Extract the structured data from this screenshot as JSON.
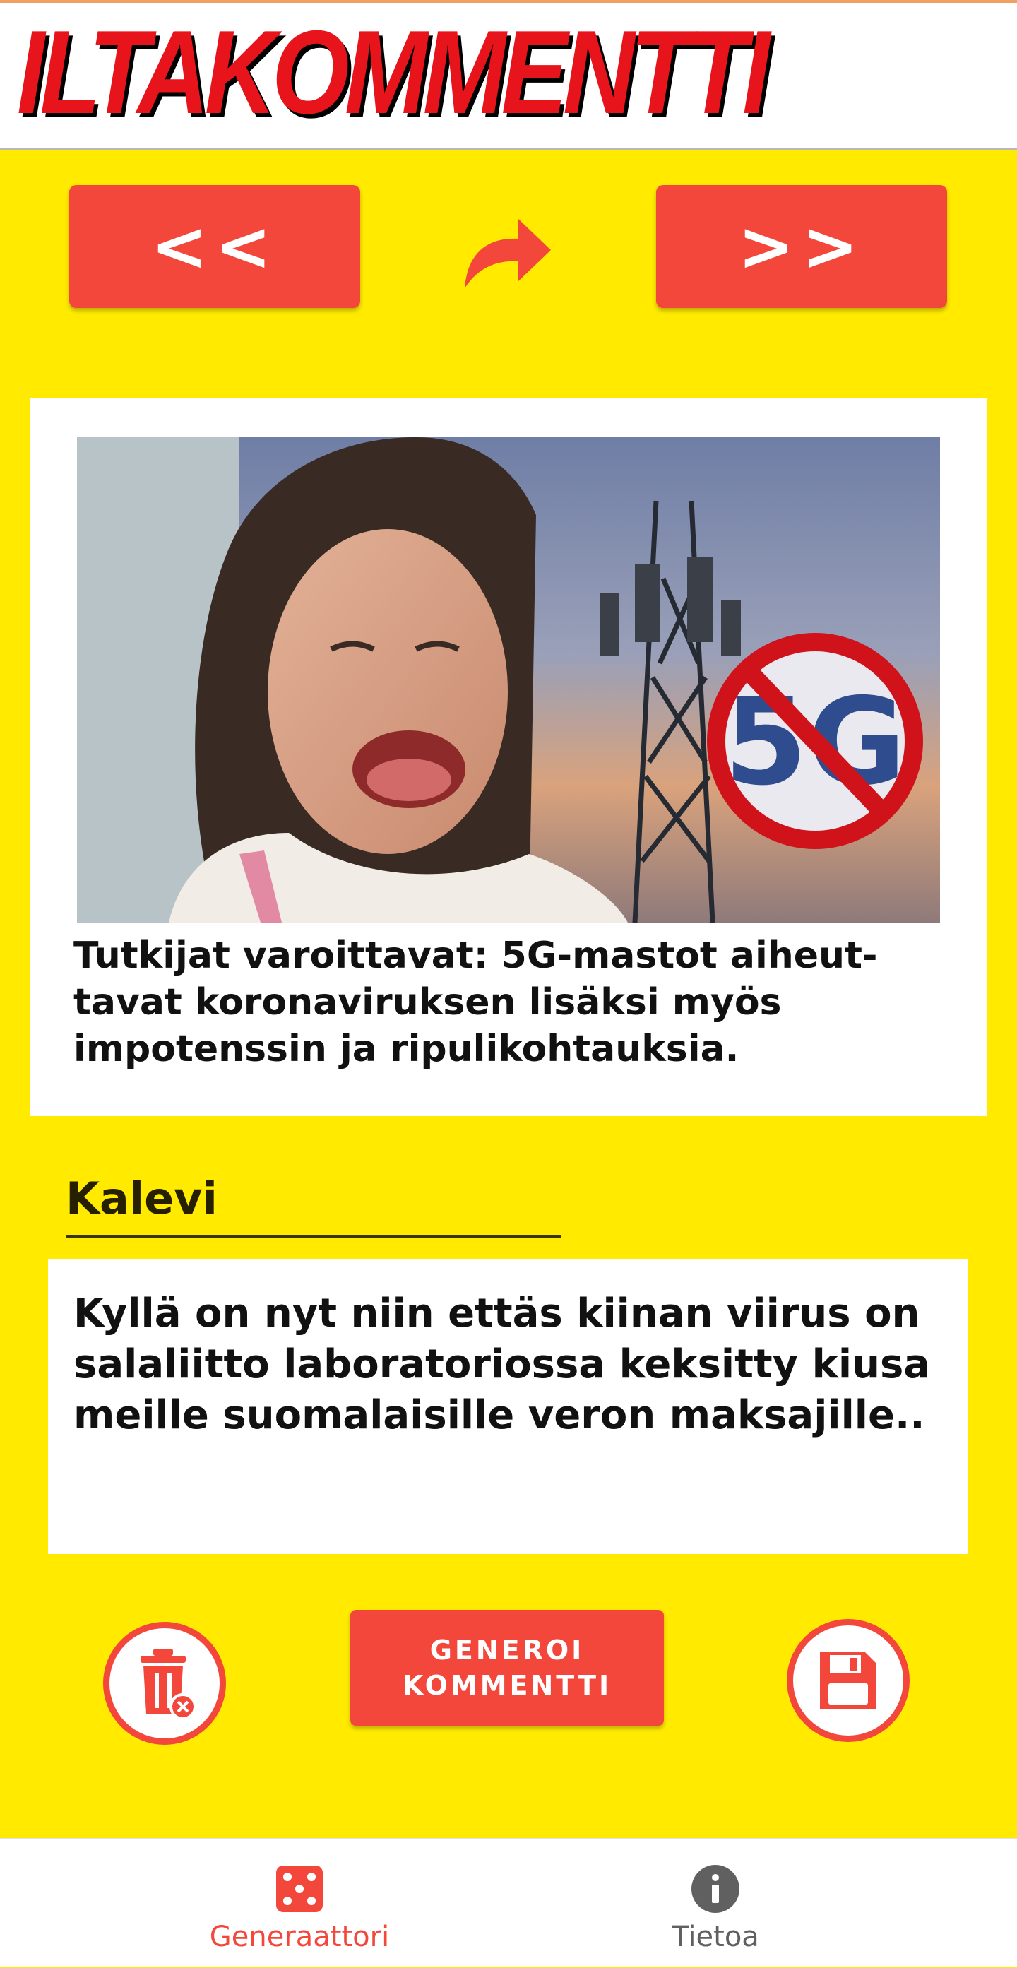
{
  "header": {
    "logo": "ILTAKOMMENTTI"
  },
  "nav": {
    "prev_label": "<<",
    "next_label": ">>",
    "share_icon": "share-arrow-icon"
  },
  "article": {
    "image_badge": "5G",
    "headline": "Tutkijat varoittavat: 5G-mastot aiheut-tavat koronaviruksen lisäksi myös impotenssin ja ripulikohtauksia."
  },
  "comment": {
    "author": "Kalevi",
    "text": "Kyllä on nyt niin ettäs kiinan viirus on salaliitto laboratoriossa keksitty kiusa meille suomalaisille veron maksajille.."
  },
  "actions": {
    "delete_icon": "trash-icon",
    "generate_line1": "GENEROI",
    "generate_line2": "KOMMENTTI",
    "save_icon": "floppy-disk-icon"
  },
  "bottom_nav": {
    "tabs": [
      {
        "label": "Generaattori",
        "icon": "dice-icon",
        "active": true,
        "color": "#f4473c"
      },
      {
        "label": "Tietoa",
        "icon": "info-icon",
        "active": false,
        "color": "#606060"
      }
    ]
  },
  "colors": {
    "background": "#ffea00",
    "accent": "#f4473c",
    "logo": "#e8141c"
  }
}
